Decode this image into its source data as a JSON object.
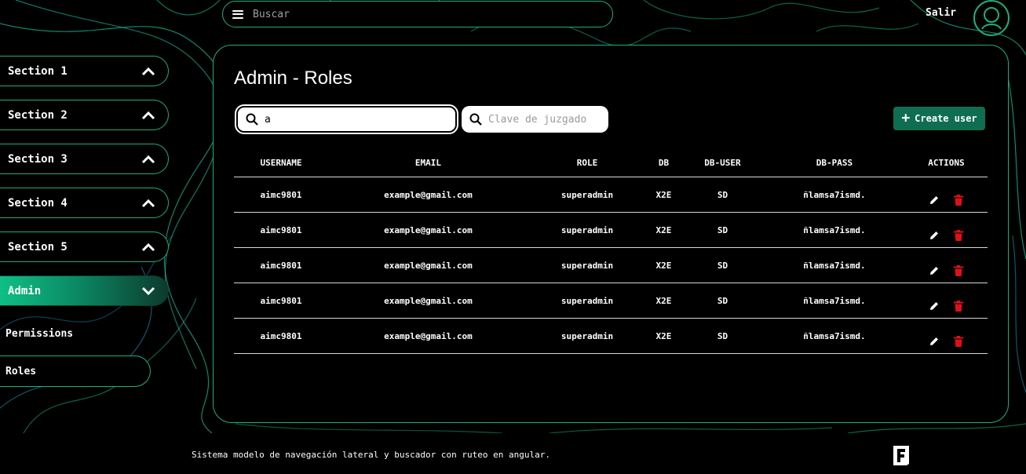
{
  "header": {
    "search_placeholder": "Buscar",
    "logout_label": "Salir"
  },
  "sidebar": {
    "items": [
      {
        "label": "Section 1"
      },
      {
        "label": "Section 2"
      },
      {
        "label": "Section 3"
      },
      {
        "label": "Section 4"
      },
      {
        "label": "Section 5"
      },
      {
        "label": "Admin"
      }
    ],
    "admin_subitems": [
      {
        "label": "Permissions"
      },
      {
        "label": "Roles"
      }
    ]
  },
  "main": {
    "title": "Admin - Roles",
    "search_value": "a",
    "court_key_placeholder": "Clave de juzgado",
    "create_button_label": "Create user",
    "columns": [
      "USERNAME",
      "EMAIL",
      "ROLE",
      "DB",
      "DB-USER",
      "DB-PASS",
      "ACTIONS"
    ],
    "rows": [
      {
        "username": "aimc9801",
        "email": "example@gmail.com",
        "role": "superadmin",
        "db": "X2E",
        "db_user": "SD",
        "db_pass": "ñlamsa7ismd."
      },
      {
        "username": "aimc9801",
        "email": "example@gmail.com",
        "role": "superadmin",
        "db": "X2E",
        "db_user": "SD",
        "db_pass": "ñlamsa7ismd."
      },
      {
        "username": "aimc9801",
        "email": "example@gmail.com",
        "role": "superadmin",
        "db": "X2E",
        "db_user": "SD",
        "db_pass": "ñlamsa7ismd."
      },
      {
        "username": "aimc9801",
        "email": "example@gmail.com",
        "role": "superadmin",
        "db": "X2E",
        "db_user": "SD",
        "db_pass": "ñlamsa7ismd."
      },
      {
        "username": "aimc9801",
        "email": "example@gmail.com",
        "role": "superadmin",
        "db": "X2E",
        "db_user": "SD",
        "db_pass": "ñlamsa7ismd."
      }
    ]
  },
  "footer": {
    "text": "Sistema modelo de navegación lateral y buscador con ruteo en angular."
  },
  "colors": {
    "accent": "#1fae7e",
    "button": "#0f6e52",
    "delete": "#e0101a"
  }
}
